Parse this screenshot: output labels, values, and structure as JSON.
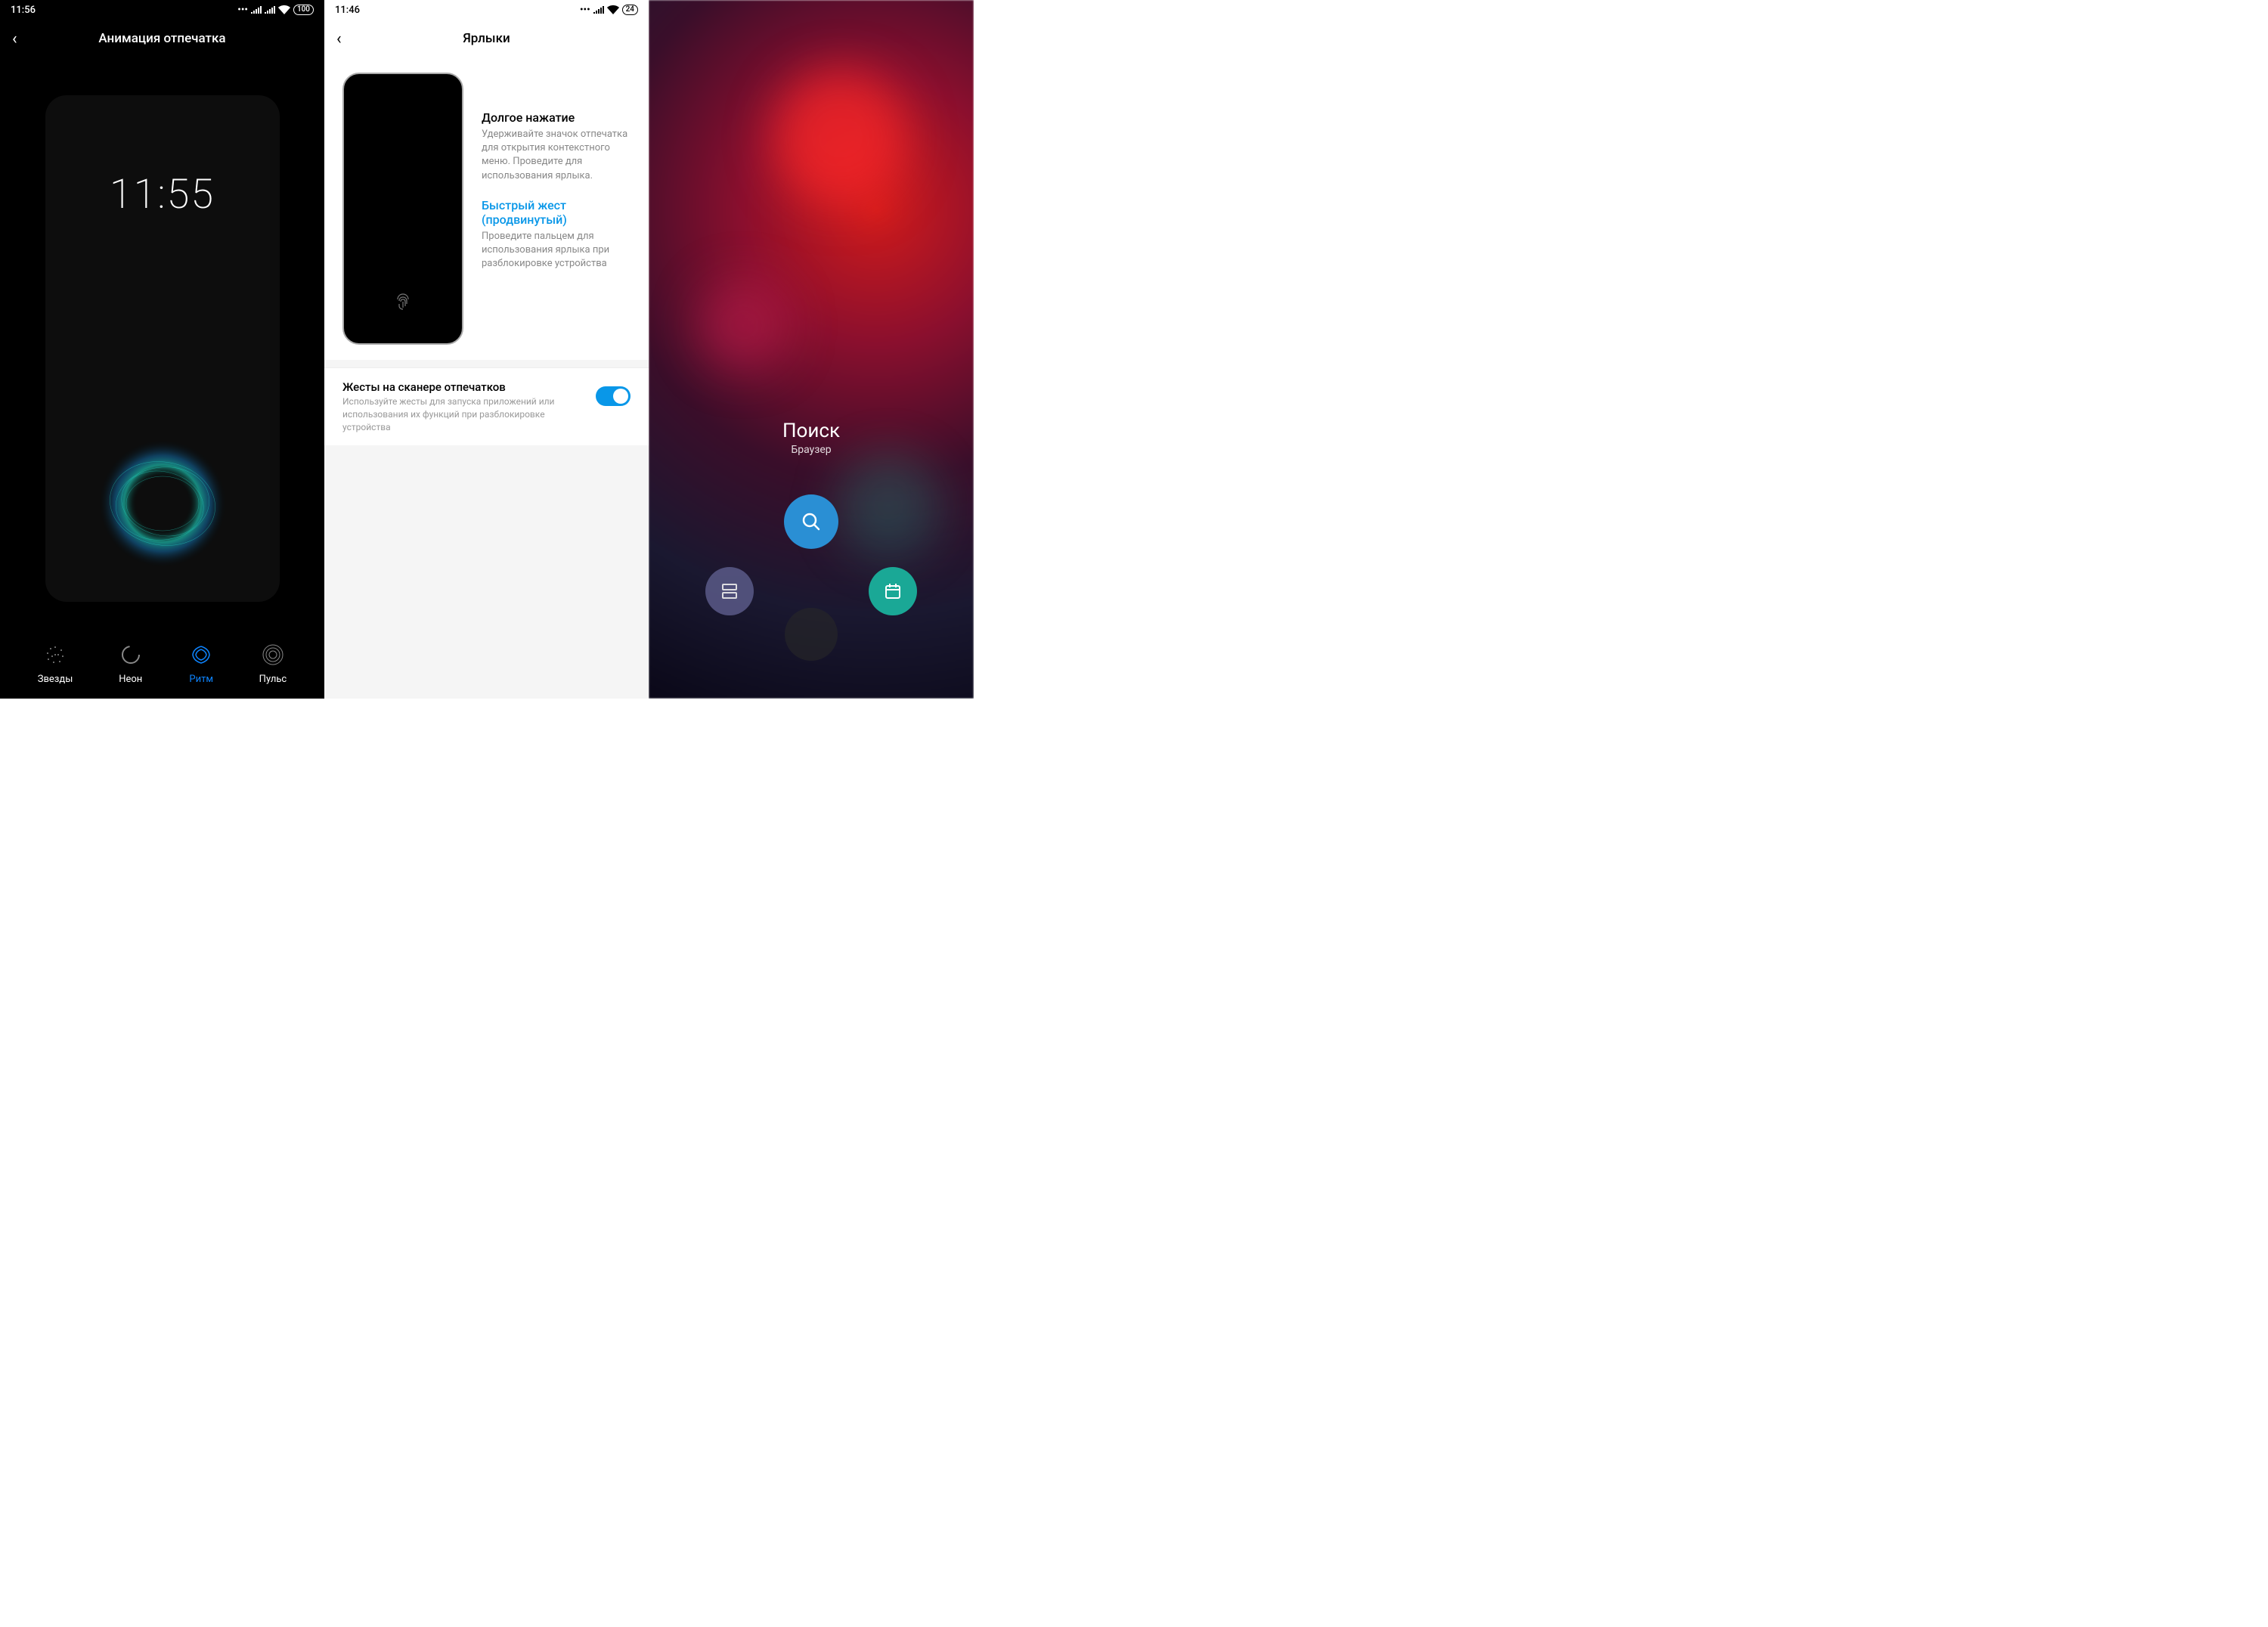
{
  "panel1": {
    "status_time": "11:56",
    "battery": "100",
    "title": "Анимация отпечатка",
    "preview_time": "11:55",
    "options": [
      {
        "label": "Звезды"
      },
      {
        "label": "Неон"
      },
      {
        "label": "Ритм"
      },
      {
        "label": "Пульс"
      }
    ],
    "active_index": 2
  },
  "panel2": {
    "status_time": "11:46",
    "battery": "24",
    "title": "Ярлыки",
    "long_press": {
      "title": "Долгое нажатие",
      "desc": "Удерживайте значок отпечатка для открытия контекстного меню. Проведите для использования ярлыка."
    },
    "quick_gesture": {
      "title": "Быстрый жест (продвинутый)",
      "desc": "Проведите пальцем для использования ярлыка при разблокировке устройства"
    },
    "setting": {
      "title": "Жесты на сканере отпечатков",
      "desc": "Используйте жесты для запуска приложений или использования их функций при разблокировке устройства",
      "enabled": true
    }
  },
  "panel3": {
    "center": {
      "title": "Поиск",
      "subtitle": "Браузер"
    },
    "buttons": {
      "top": "search-icon",
      "left": "split-screen-icon",
      "right": "calendar-icon",
      "center": "fingerprint-icon"
    }
  }
}
